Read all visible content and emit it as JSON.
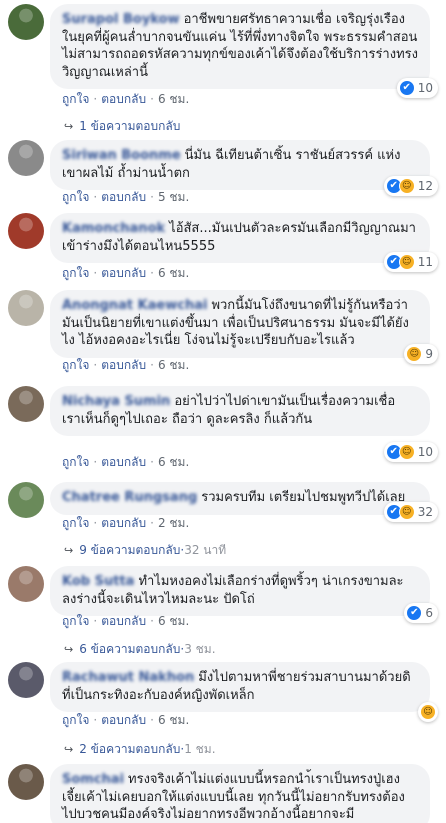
{
  "ui": {
    "like_label": "ถูกใจ",
    "reply_label": "ตอบกลับ",
    "separator": "·"
  },
  "colors": {
    "bubble": "#f2f3f5",
    "name": "#385898",
    "like": "#1877f2",
    "haha": "#f7b125",
    "meta": "#606770"
  },
  "comments": [
    {
      "name": "Surapol Boykow",
      "text": "อาชีพขายศรัทธาความเชื่อ เจริญรุ่งเรืองในยุคที่ผู้คนล่ำบากจนขันแค่น ไร้ที่พึ่งทางจิตใจ พระธรรมคำสอนไม่สามารถถอดรหัสความทุกข์ของเค้าได้จึงต้องใช้บริการร่างทรงวิญญาณเหล่านี้",
      "time": "6 ชม.",
      "reaction_icons": [
        "like-icon"
      ],
      "reaction_count": "10",
      "avatar_color": "#4a6b3a",
      "replies": {
        "label": "1 ข้อความตอบกลับ",
        "meta": ""
      }
    },
    {
      "name": "Siriwan Boonme",
      "text": "นี่มัน ฉีเทียนต้าเซิ้น ราชันย์สวรรค์ แห่งเขาผลไม้ ถ้ำม่านน้ำตก",
      "time": "5 ชม.",
      "reaction_icons": [
        "like-icon",
        "haha-icon"
      ],
      "reaction_count": "12",
      "avatar_color": "#8a8a8a",
      "replies": null
    },
    {
      "name": "Kamonchanok",
      "text": "ไอ้สัส...มันเปนตัวละครมันเลือกมีวิญญาณมาเข้าร่างมึงได้ตอนไหน5555",
      "time": "6 ชม.",
      "reaction_icons": [
        "like-icon",
        "haha-icon"
      ],
      "reaction_count": "11",
      "avatar_color": "#a03a2a",
      "replies": null
    },
    {
      "name": "Anongnat Kaewchai",
      "text": "พวกนี้มันโง่ถึงขนาดที่ไม่รู้กันหรือว่า มันเป็นนิยายที่เขาแต่งขึ้นมา เพื่อเป็นปริศนาธรรม มันจะมีได้ยังไง ไอ้หงอคงอะไรเนี่ย โง่จนไม่รู้จะเปรียบกับอะไรแล้ว",
      "time": "6 ชม.",
      "reaction_icons": [
        "haha-icon"
      ],
      "reaction_count": "9",
      "avatar_color": "#b9b4a8",
      "replies": null
    },
    {
      "name": "Nichaya Sumin",
      "text": "อย่าไปว่าไปด่าเขามันเป็นเรื่องความเชื่อ เราเห็นก็ดูๆไปเถอะ ถือว่า ดูละครลิง ก็แล้วกัน",
      "time": "6 ชม.",
      "reaction_icons": [
        "like-icon",
        "haha-icon"
      ],
      "reaction_count": "10",
      "avatar_color": "#7a6a5a",
      "replies": null
    },
    {
      "name": "Chatree Rungsang",
      "text": "รวมครบทีม เตรียมไปชมพูทวีปได้เลย",
      "time": "2 ชม.",
      "reaction_icons": [
        "like-icon",
        "haha-icon"
      ],
      "reaction_count": "32",
      "avatar_color": "#6a8a5a",
      "replies": {
        "label": "9 ข้อความตอบกลับ",
        "meta": "32 นาที"
      }
    },
    {
      "name": "Kob Sutta",
      "text": "ทำไมหงอคงไม่เลือกร่างที่ดูพริ้วๆ น่าเกรงขามละ ลงร่างนี้จะเดินไหวไหมละนะ ปัดโถ่",
      "time": "6 ชม.",
      "reaction_icons": [
        "like-icon"
      ],
      "reaction_count": "6",
      "avatar_color": "#9a7a6a",
      "replies": {
        "label": "6 ข้อความตอบกลับ",
        "meta": "3 ชม."
      }
    },
    {
      "name": "Rachawut Nakhon",
      "text": "มึงไปตามหาพี่ชายร่วมสาบานมาด้วยดิ ที่เป็นกระทิงอะกับองค์หญิงพัดเหล็ก",
      "time": "6 ชม.",
      "reaction_icons": [
        "haha-icon"
      ],
      "reaction_count": "",
      "avatar_color": "#5a5a6a",
      "replies": {
        "label": "2 ข้อความตอบกลับ",
        "meta": "1 ชม."
      }
    },
    {
      "name": "Somchai",
      "text": "ทรงจริงเค้าไม่แต่งแบบนี้หรอกนำ้เราเป็นทรงปู่เฮงเจี้ยเค้าไม่เคยบอกให้แต่งแบบนี้เลย ทุกวันนี้ไม่อยากรับทรงต้องไปบวชคนมีองค์จริงไม่อยากทรงอีพวกอ้างนี้อยากจะมี",
      "time": "",
      "reaction_icons": [],
      "reaction_count": "",
      "avatar_color": "#6a5a4a",
      "replies": null
    }
  ]
}
